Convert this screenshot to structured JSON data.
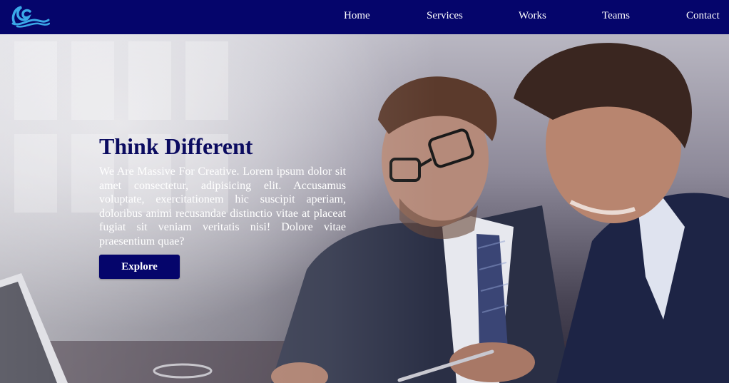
{
  "nav": {
    "items": [
      {
        "label": "Home"
      },
      {
        "label": "Services"
      },
      {
        "label": "Works"
      },
      {
        "label": "Teams"
      },
      {
        "label": "Contact"
      }
    ]
  },
  "hero": {
    "title": "Think Different",
    "text": "We Are Massive For Creative. Lorem ipsum dolor sit amet consectetur, adipisicing elit. Accusamus voluptate, exercitationem hic suscipit aperiam, doloribus animi recusandae distinctio vitae at placeat fugiat sit veniam veritatis nisi! Dolore vitae praesentium quae?",
    "button_label": "Explore"
  },
  "colors": {
    "navbar_bg": "#05056b",
    "title": "#0b0b60",
    "button_bg": "#05056b",
    "logo_blue": "#3aa8e8"
  },
  "icons": {
    "logo": "wave-logo-icon"
  }
}
